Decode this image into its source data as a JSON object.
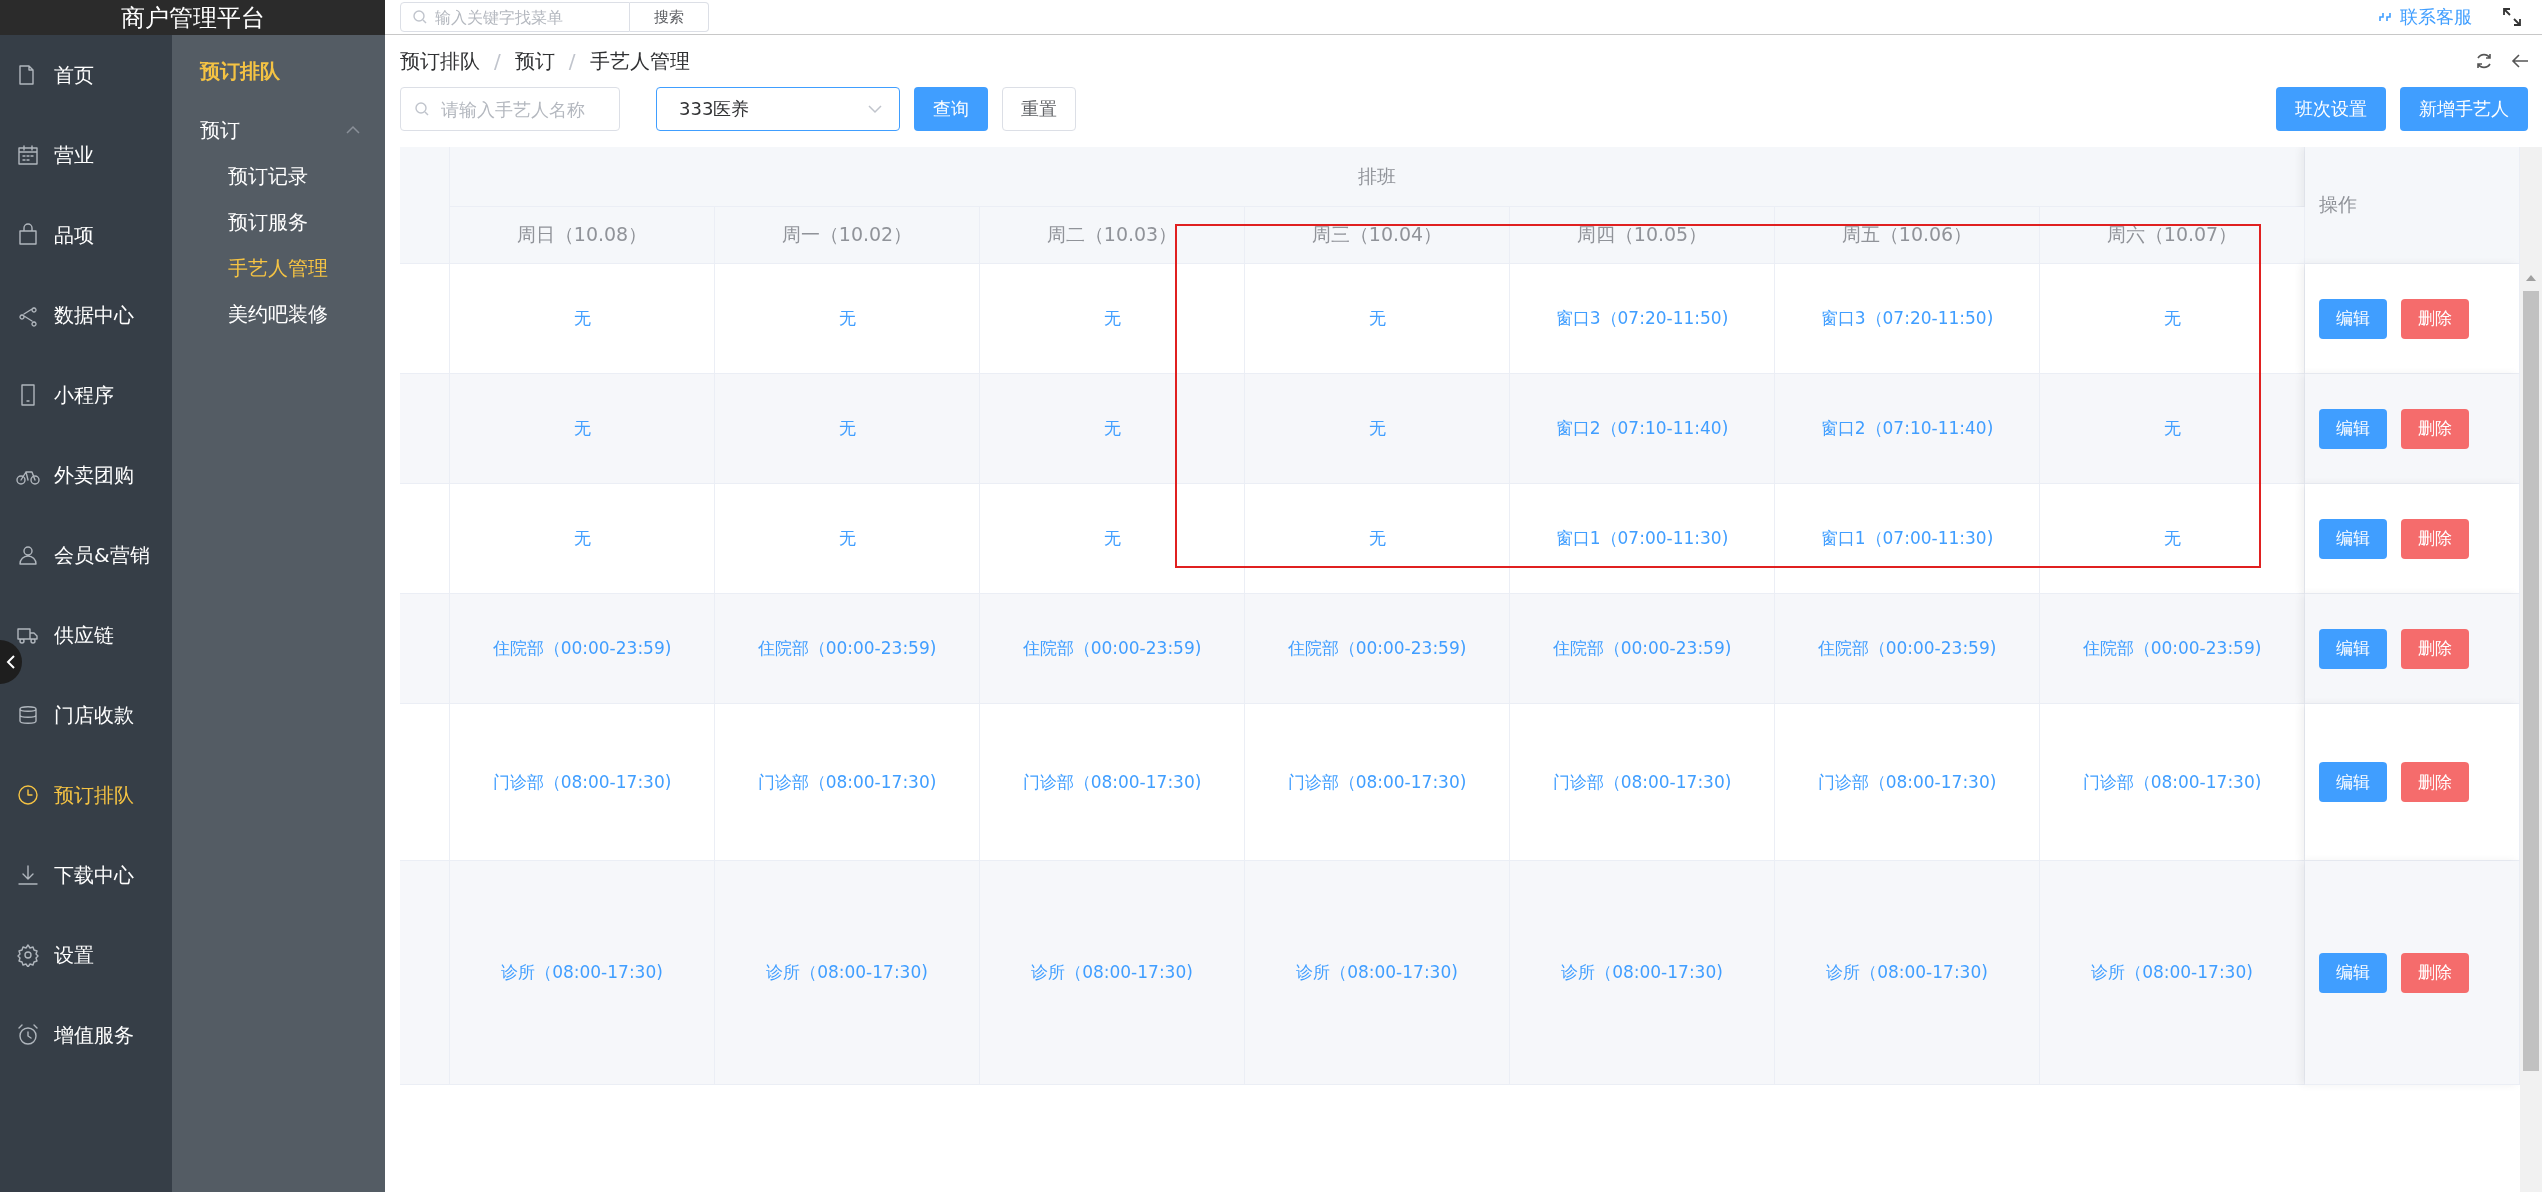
{
  "top_bar": {
    "logo": "商户管理平台",
    "menu_search": {
      "placeholder": "输入关键字找菜单"
    },
    "search_button": "搜索",
    "support_link": "联系客服"
  },
  "nav": [
    {
      "label": "首页",
      "selected": false
    },
    {
      "label": "营业",
      "selected": false
    },
    {
      "label": "品项",
      "selected": false
    },
    {
      "label": "数据中心",
      "selected": false
    },
    {
      "label": "小程序",
      "selected": false
    },
    {
      "label": "外卖团购",
      "selected": false
    },
    {
      "label": "会员&营销",
      "selected": false
    },
    {
      "label": "供应链",
      "selected": false
    },
    {
      "label": "门店收款",
      "selected": false
    },
    {
      "label": "预订排队",
      "selected": true
    },
    {
      "label": "下载中心",
      "selected": false
    },
    {
      "label": "设置",
      "selected": false
    },
    {
      "label": "增值服务",
      "selected": false
    }
  ],
  "subnav": {
    "title": "预订排队",
    "groups": [
      {
        "label": "预订",
        "expanded": true,
        "items": [
          {
            "label": "预订记录",
            "selected": false
          },
          {
            "label": "预订服务",
            "selected": false
          },
          {
            "label": "手艺人管理",
            "selected": true
          },
          {
            "label": "美约吧装修",
            "selected": false
          }
        ]
      }
    ]
  },
  "breadcrumb": [
    {
      "label": "预订排队"
    },
    {
      "separator": "/",
      "label": "预订"
    },
    {
      "separator": "/",
      "label": "手艺人管理"
    }
  ],
  "toolbar": {
    "name_search": {
      "placeholder": "请输入手艺人名称"
    },
    "store_select": {
      "value": "333医养"
    },
    "buttons": [
      {
        "label": "查询",
        "kind": "primary"
      },
      {
        "label": "重置",
        "kind": "default"
      }
    ],
    "right_buttons": [
      {
        "label": "班次设置",
        "kind": "primary"
      },
      {
        "label": "新增手艺人",
        "kind": "primary"
      }
    ]
  },
  "table": {
    "group_header": "排班",
    "actions_header": "操作",
    "columns": [
      "周日（10.08）",
      "周一（10.02）",
      "周二（10.03）",
      "周三（10.04）",
      "周四（10.05）",
      "周五（10.06）",
      "周六（10.07）"
    ],
    "rows": [
      {
        "cells": [
          "无",
          "无",
          "无",
          "无",
          "窗口3（07:20-11:50)",
          "窗口3（07:20-11:50)",
          "无"
        ],
        "actions": [
          {
            "label": "编辑",
            "kind": "edit"
          },
          {
            "label": "删除",
            "kind": "delete"
          }
        ]
      },
      {
        "cells": [
          "无",
          "无",
          "无",
          "无",
          "窗口2（07:10-11:40)",
          "窗口2（07:10-11:40)",
          "无"
        ],
        "actions": [
          {
            "label": "编辑",
            "kind": "edit"
          },
          {
            "label": "删除",
            "kind": "delete"
          }
        ]
      },
      {
        "cells": [
          "无",
          "无",
          "无",
          "无",
          "窗口1（07:00-11:30)",
          "窗口1（07:00-11:30)",
          "无"
        ],
        "actions": [
          {
            "label": "编辑",
            "kind": "edit"
          },
          {
            "label": "删除",
            "kind": "delete"
          }
        ]
      },
      {
        "cells": [
          "住院部（00:00-23:59)",
          "住院部（00:00-23:59)",
          "住院部（00:00-23:59)",
          "住院部（00:00-23:59)",
          "住院部（00:00-23:59)",
          "住院部（00:00-23:59)",
          "住院部（00:00-23:59)"
        ],
        "actions": [
          {
            "label": "编辑",
            "kind": "edit"
          },
          {
            "label": "删除",
            "kind": "delete"
          }
        ]
      },
      {
        "cells": [
          "门诊部（08:00-17:30)",
          "门诊部（08:00-17:30)",
          "门诊部（08:00-17:30)",
          "门诊部（08:00-17:30)",
          "门诊部（08:00-17:30)",
          "门诊部（08:00-17:30)",
          "门诊部（08:00-17:30)"
        ],
        "actions": [
          {
            "label": "编辑",
            "kind": "edit"
          },
          {
            "label": "删除",
            "kind": "delete"
          }
        ]
      },
      {
        "cells": [
          "诊所（08:00-17:30)",
          "诊所（08:00-17:30)",
          "诊所（08:00-17:30)",
          "诊所（08:00-17:30)",
          "诊所（08:00-17:30)",
          "诊所（08:00-17:30)",
          "诊所（08:00-17:30)"
        ],
        "actions": [
          {
            "label": "编辑",
            "kind": "edit"
          },
          {
            "label": "删除",
            "kind": "delete"
          }
        ]
      }
    ]
  }
}
